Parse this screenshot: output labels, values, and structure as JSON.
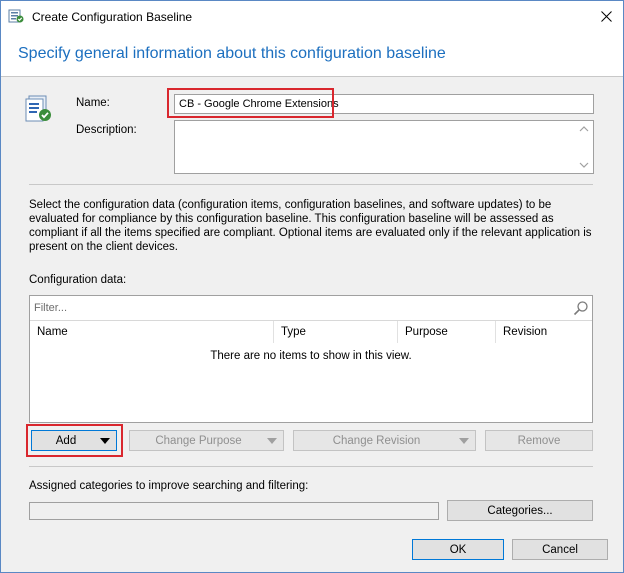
{
  "window": {
    "title": "Create Configuration Baseline",
    "header": "Specify general information about this configuration baseline"
  },
  "form": {
    "name_label": "Name:",
    "name_value": "CB - Google Chrome Extensions",
    "description_label": "Description:",
    "description_value": ""
  },
  "info_text": "Select the configuration data (configuration items, configuration baselines, and software updates) to be evaluated for compliance by this configuration baseline. This configuration baseline will be assessed as compliant if all the items specified are compliant. Optional items are evaluated only if the relevant application is present on  the client devices.",
  "config_data": {
    "label": "Configuration data:",
    "filter_placeholder": "Filter...",
    "columns": [
      "Name",
      "Type",
      "Purpose",
      "Revision"
    ],
    "empty_message": "There are no items to show in this view."
  },
  "actions": {
    "add": "Add",
    "change_purpose": "Change Purpose",
    "change_revision": "Change Revision",
    "remove": "Remove"
  },
  "categories": {
    "label": "Assigned categories to improve searching and filtering:",
    "value": "",
    "button": "Categories..."
  },
  "footer": {
    "ok": "OK",
    "cancel": "Cancel"
  },
  "colors": {
    "header_text": "#1c6fbf",
    "highlight_box": "#d9272e",
    "window_border": "#5a88c4"
  }
}
